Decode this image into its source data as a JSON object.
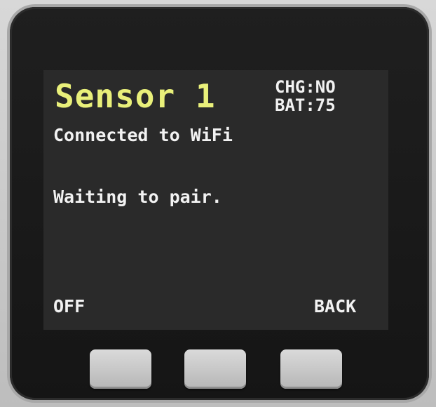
{
  "device": {
    "screen": {
      "title": "Sensor 1",
      "status_charging": "CHG:NO",
      "status_battery": "BAT:75",
      "line1": "Connected to WiFi",
      "line2": "Waiting to pair.",
      "softkey_left": "OFF",
      "softkey_right": "BACK"
    },
    "colors": {
      "title": "#e9f07a",
      "text": "#f2f2f2",
      "screen_bg": "#2a2a2a",
      "bezel": "#1a1a1a",
      "button": "#c8c8c8"
    },
    "hardware_buttons": [
      "left-button",
      "middle-button",
      "right-button"
    ]
  }
}
